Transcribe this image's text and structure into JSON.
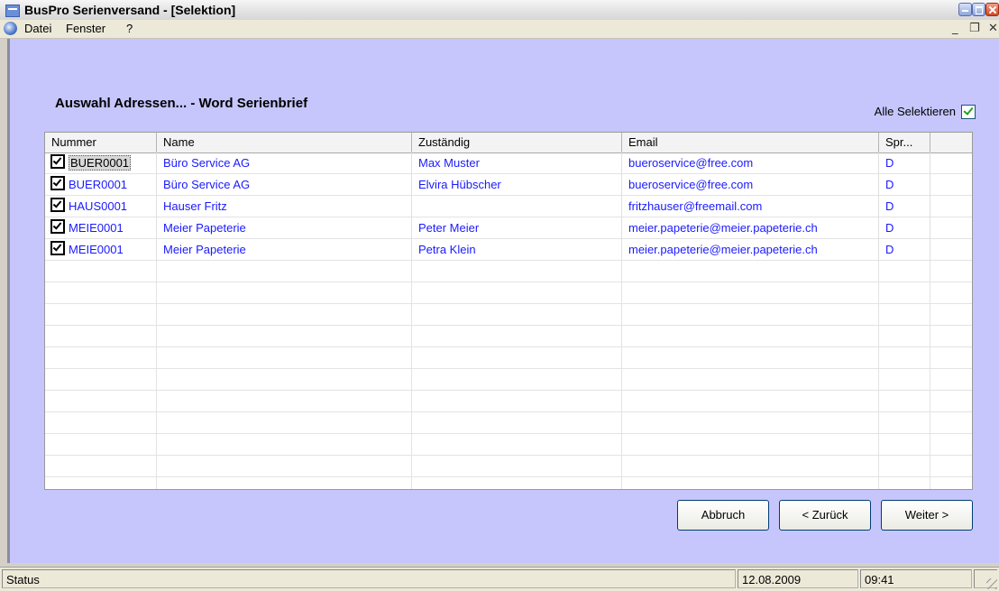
{
  "window": {
    "title": "BusPro Serienversand - [Selektion]"
  },
  "menu": {
    "items": [
      "Datei",
      "Fenster",
      "?"
    ]
  },
  "heading": "Auswahl Adressen... - Word Serienbrief",
  "select_all": {
    "label": "Alle Selektieren",
    "checked": true
  },
  "grid": {
    "columns": [
      "Nummer",
      "Name",
      "Zuständig",
      "Email",
      "Spr..."
    ],
    "rows": [
      {
        "checked": true,
        "nummer": "BUER0001",
        "name": "Büro Service AG",
        "zustaendig": "Max Muster",
        "email": "bueroservice@free.com",
        "sprache": "D"
      },
      {
        "checked": true,
        "nummer": "BUER0001",
        "name": "Büro Service AG",
        "zustaendig": "Elvira Hübscher",
        "email": "bueroservice@free.com",
        "sprache": "D"
      },
      {
        "checked": true,
        "nummer": "HAUS0001",
        "name": "Hauser Fritz",
        "zustaendig": "",
        "email": "fritzhauser@freemail.com",
        "sprache": "D"
      },
      {
        "checked": true,
        "nummer": "MEIE0001",
        "name": "Meier Papeterie",
        "zustaendig": "Peter Meier",
        "email": "meier.papeterie@meier.papeterie.ch",
        "sprache": "D"
      },
      {
        "checked": true,
        "nummer": "MEIE0001",
        "name": "Meier Papeterie",
        "zustaendig": "Petra Klein",
        "email": "meier.papeterie@meier.papeterie.ch",
        "sprache": "D"
      }
    ]
  },
  "buttons": {
    "cancel": "Abbruch",
    "back": "< Zurück",
    "next": "Weiter >"
  },
  "status": {
    "text": "Status",
    "date": "12.08.2009",
    "time": "09:41"
  },
  "colors": {
    "client_bg": "#c6c6fd",
    "link_text": "#1a1aff"
  }
}
